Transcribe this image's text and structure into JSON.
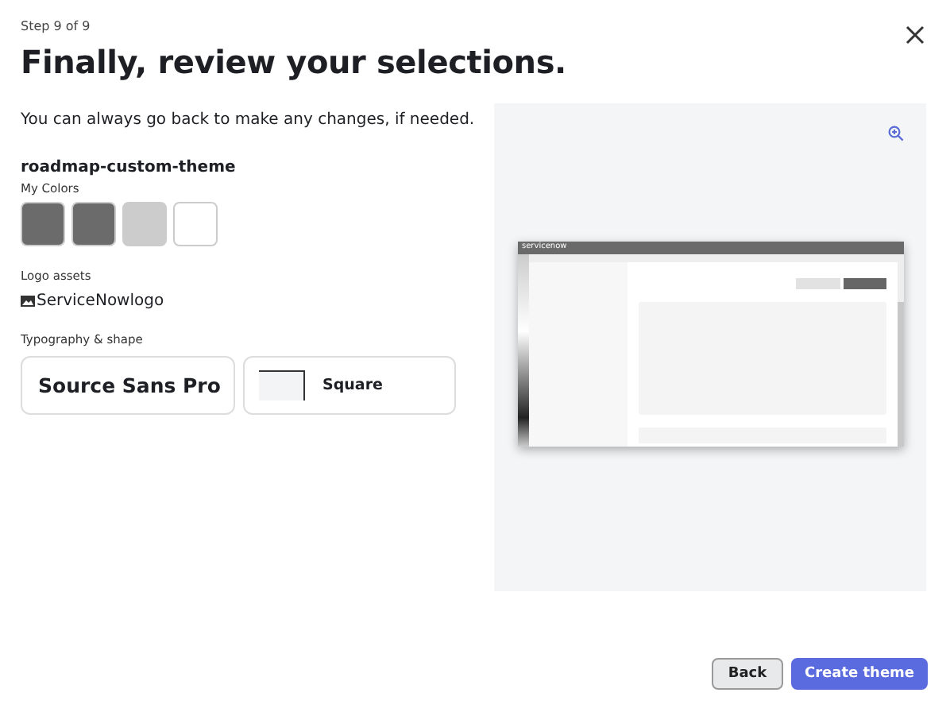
{
  "step": "Step 9 of 9",
  "title": "Finally, review your selections.",
  "intro": "You can always go back to make any changes, if needed.",
  "theme_name": "roadmap-custom-theme",
  "colors_label": "My Colors",
  "colors": [
    {
      "color": "#6b6b6b"
    },
    {
      "color": "#6b6b6b"
    },
    {
      "color": "#cccccc"
    },
    {
      "color": "#ffffff"
    }
  ],
  "logo_label": "Logo assets",
  "logo_file": "ServiceNowlogo",
  "typography_label": "Typography & shape",
  "font_card": "Source Sans Pro",
  "shape_card": "Square",
  "preview": {
    "logo_text": "servicenow"
  },
  "buttons": [
    {
      "label": "Back",
      "kind": "secondary"
    },
    {
      "label": "Create theme",
      "kind": "primary"
    }
  ]
}
